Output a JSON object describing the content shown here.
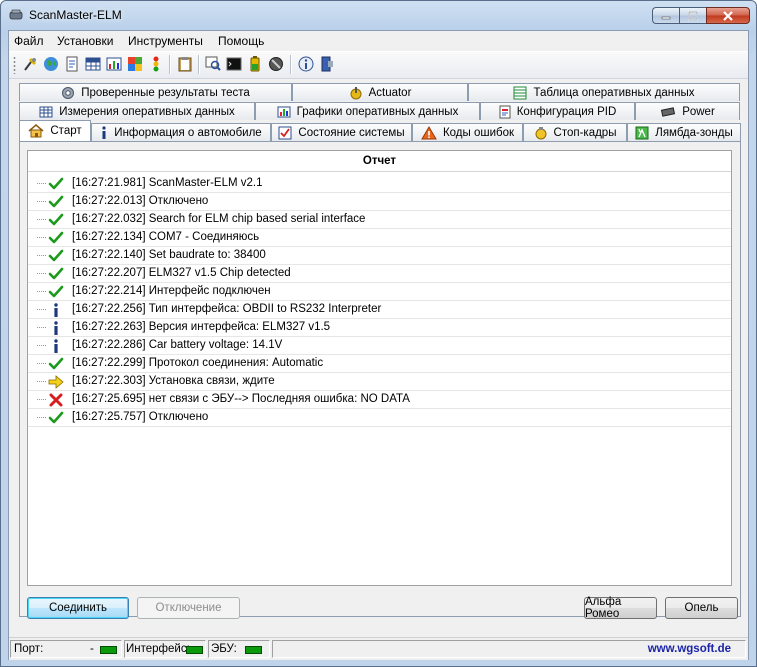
{
  "window": {
    "title": "ScanMaster-ELM"
  },
  "menu": [
    "Файл",
    "Установки",
    "Инструменты",
    "Помощь"
  ],
  "toolbar": {
    "buttons": [
      "connect-icon",
      "globe-icon",
      "document-icon",
      "grid-icon",
      "chart-icon",
      "flag-icon",
      "traffic-light-icon",
      "clipboard-icon",
      "search-icon",
      "terminal-icon",
      "battery-icon",
      "sensor-icon",
      "info-icon",
      "exit-icon"
    ]
  },
  "tabs": {
    "row1": [
      {
        "label": "Проверенные результаты теста",
        "icon": "gear-icon"
      },
      {
        "label": "Actuator",
        "icon": "actuator-icon"
      },
      {
        "label": "Таблица оперативных данных",
        "icon": "table-icon"
      }
    ],
    "row2": [
      {
        "label": "Измерения оперативных данных",
        "icon": "grid-icon"
      },
      {
        "label": "Графики оперативных данных",
        "icon": "chart-icon"
      },
      {
        "label": "Конфигурация PID",
        "icon": "document-icon"
      },
      {
        "label": "Power",
        "icon": "chip-icon"
      }
    ],
    "row3": [
      {
        "label": "Старт",
        "icon": "home-icon",
        "active": true
      },
      {
        "label": "Информация о автомобиле",
        "icon": "info-icon"
      },
      {
        "label": "Состояние системы",
        "icon": "checklist-icon"
      },
      {
        "label": "Коды ошибок",
        "icon": "warning-icon"
      },
      {
        "label": "Стоп-кадры",
        "icon": "freeze-frame-icon"
      },
      {
        "label": "Лямбда-зонды",
        "icon": "lambda-icon"
      }
    ]
  },
  "report": {
    "title": "Отчет",
    "entries": [
      {
        "icon": "check",
        "text": "[16:27:21.981] ScanMaster-ELM v2.1"
      },
      {
        "icon": "check",
        "text": "[16:27:22.013] Отключено"
      },
      {
        "icon": "check",
        "text": "[16:27:22.032] Search for ELM chip based serial interface"
      },
      {
        "icon": "check",
        "text": "[16:27:22.134] COM7 - Соединяюсь"
      },
      {
        "icon": "check",
        "text": "[16:27:22.140] Set baudrate to: 38400"
      },
      {
        "icon": "check",
        "text": "[16:27:22.207] ELM327 v1.5 Chip detected"
      },
      {
        "icon": "check",
        "text": "[16:27:22.214] Интерфейс подключен"
      },
      {
        "icon": "info",
        "text": "[16:27:22.256] Тип интерфейса: OBDII to RS232 Interpreter"
      },
      {
        "icon": "info",
        "text": "[16:27:22.263] Версия интерфейса: ELM327 v1.5"
      },
      {
        "icon": "info",
        "text": "[16:27:22.286] Car battery voltage: 14.1V"
      },
      {
        "icon": "check",
        "text": "[16:27:22.299] Протокол соединения: Automatic"
      },
      {
        "icon": "arrow",
        "text": "[16:27:22.303] Установка связи, ждите"
      },
      {
        "icon": "error",
        "text": "[16:27:25.695] нет связи с ЭБУ--> Последняя ошибка: NO DATA"
      },
      {
        "icon": "check",
        "text": "[16:27:25.757] Отключено"
      }
    ]
  },
  "buttons": {
    "connect": "Соединить",
    "disconnect": "Отключение",
    "alfa": "Альфа Ромео",
    "opel": "Опель"
  },
  "status": {
    "port_label": "Порт:",
    "port_value": "-",
    "interface_label": "Интерфейс:",
    "ecu_label": "ЭБУ:",
    "link": "www.wgsoft.de",
    "led_color": "#0b9a0b"
  }
}
